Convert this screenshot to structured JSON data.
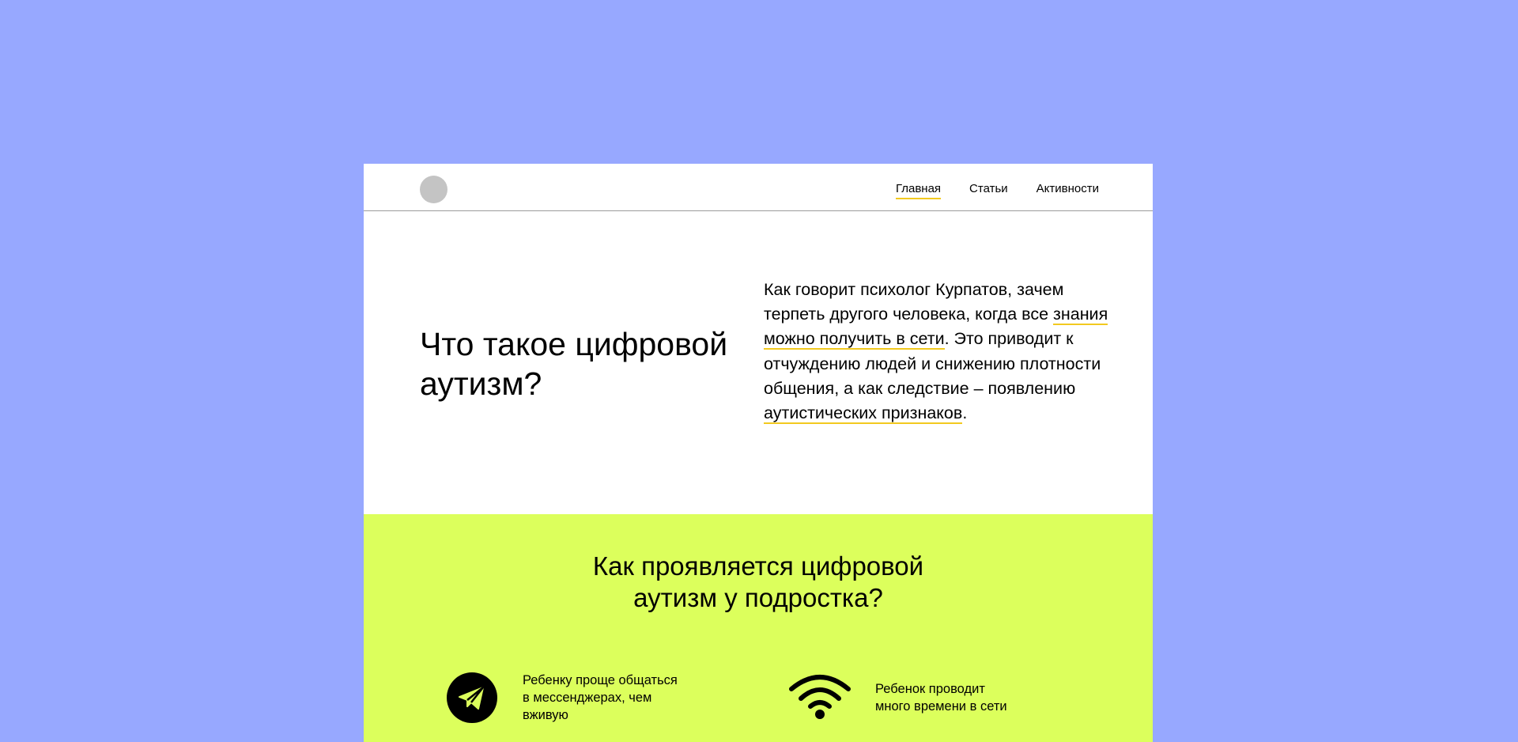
{
  "nav": {
    "items": [
      {
        "label": "Главная",
        "active": true
      },
      {
        "label": "Статьи",
        "active": false
      },
      {
        "label": "Активности",
        "active": false
      }
    ]
  },
  "intro": {
    "title": "Что такое цифровой аутизм?",
    "text_part1": "Как говорит психолог Курпатов, зачем терпеть другого человека, когда все ",
    "link1": "знания можно получить в сети",
    "text_part2": ". Это приводит к отчуждению людей и снижению плотности общения, а как следствие – появлению ",
    "link2": "аутистических признаков",
    "text_part3": "."
  },
  "symptoms": {
    "title": "Как проявляется цифровой\nаутизм у подростка?",
    "items": [
      {
        "icon": "telegram-icon",
        "text": "Ребенку проще общаться\nв мессенджерах, чем\nвживую"
      },
      {
        "icon": "wifi-icon",
        "text": "Ребенок проводит\nмного времени в сети"
      }
    ]
  },
  "colors": {
    "background": "#97a8ff",
    "accent_green": "#dcff5c",
    "underline_yellow": "#f2c91f"
  }
}
